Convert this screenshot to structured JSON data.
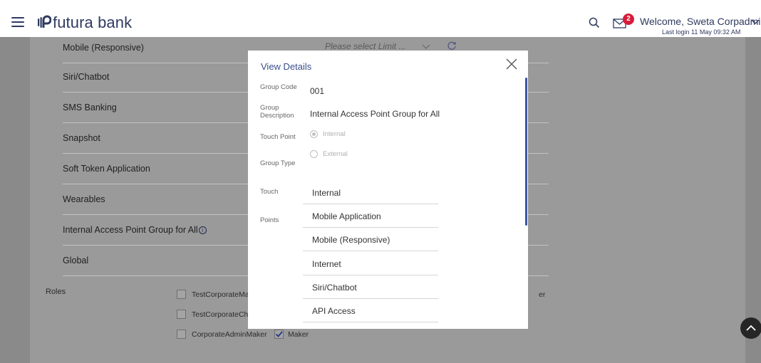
{
  "header": {
    "brand": "futura bank",
    "badge_count": "2",
    "welcome": "Welcome, Sweta Corpadmin",
    "last_login": "Last login 11 May 09:32 AM"
  },
  "background": {
    "limit_select_placeholder": "Please select Limit ...",
    "items": [
      {
        "label": "Mobile (Responsive)"
      },
      {
        "label": "Siri/Chatbot"
      },
      {
        "label": "SMS Banking"
      },
      {
        "label": "Snapshot"
      },
      {
        "label": "Soft Token Application"
      },
      {
        "label": "Wearables"
      },
      {
        "label": "Internal Access Point Group for All"
      },
      {
        "label": "Global"
      }
    ],
    "info_glyph": "i",
    "roles_label": "Roles",
    "roles": [
      {
        "label": "TestCorporateMa",
        "checked": false
      },
      {
        "label": "TestCorporateChe",
        "checked": false
      },
      {
        "label": "CorporateAdminMaker",
        "checked": false
      },
      {
        "label": "Maker",
        "checked": true
      }
    ],
    "trailing_text": "er"
  },
  "modal": {
    "title": "View Details",
    "group_code_label": "Group Code",
    "group_code": "001",
    "group_description_label": "Group Description",
    "group_description": "Internal Access Point Group for All",
    "touch_point_label": "Touch Point",
    "touch_point_options": [
      {
        "label": "Internal",
        "selected": true
      },
      {
        "label": "External",
        "selected": false
      }
    ],
    "group_type_label": "Group Type",
    "touch_points_label_1": "Touch",
    "touch_points_label_2": "Points",
    "touch_points": [
      "Internal",
      "Mobile Application",
      "Mobile (Responsive)",
      "Internet",
      "Siri/Chatbot",
      "API Access"
    ]
  },
  "colors": {
    "brand": "#2f3a60",
    "accent": "#3d55a3",
    "badge": "#d81b3a",
    "overlay": "#8a8a8a"
  },
  "icons": [
    "hamburger-icon",
    "futura-logo-icon",
    "search-icon",
    "mail-icon",
    "chevron-down-icon",
    "refresh-icon",
    "info-icon",
    "close-icon",
    "scroll-up-icon"
  ]
}
